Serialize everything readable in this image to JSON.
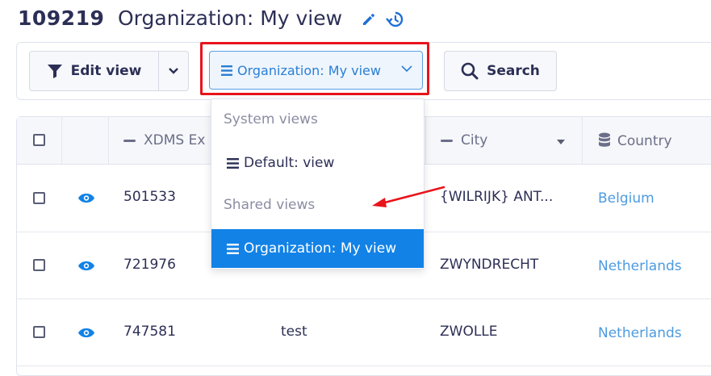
{
  "header": {
    "record_id": "109219",
    "title": "Organization: My view"
  },
  "toolbar": {
    "edit_view_label": "Edit view",
    "view_select_label": "Organization: My view",
    "search_label": "Search"
  },
  "table": {
    "columns": [
      {
        "label": "XDMS Ex"
      },
      {
        "label": "City"
      },
      {
        "label": "Country"
      }
    ],
    "rows": [
      {
        "id": "501533",
        "name": "",
        "city": "{WILRIJK} ANT...",
        "country": "Belgium"
      },
      {
        "id": "721976",
        "name": "",
        "city": "ZWYNDRECHT",
        "country": "Netherlands"
      },
      {
        "id": "747581",
        "name": "test",
        "city": "ZWOLLE",
        "country": "Netherlands"
      }
    ]
  },
  "dropdown": {
    "system_header": "System views",
    "system_items": [
      {
        "label": "Default: view"
      }
    ],
    "shared_header": "Shared views",
    "shared_items": [
      {
        "label": "Organization: My view",
        "selected": true
      }
    ]
  },
  "colors": {
    "accent": "#1282e6",
    "highlight": "#e8141b",
    "link": "#4d9be0",
    "text": "#2c2f55"
  }
}
